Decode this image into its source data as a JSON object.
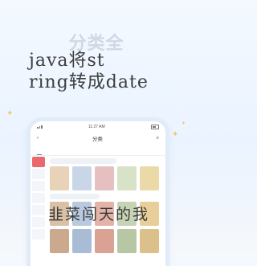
{
  "hero": {
    "title": "分类全"
  },
  "overlay": {
    "line1": "java将st",
    "line2": "ring转成date"
  },
  "phone": {
    "time": "11:27 AM",
    "appbar_title": "分类",
    "tabs": [
      "",
      "",
      "",
      ""
    ],
    "sidebar": [
      "",
      "",
      "",
      "",
      "",
      "",
      "",
      ""
    ]
  },
  "bottom": {
    "text": "韭菜闯天的我"
  },
  "colors": {
    "accent": "#3b7bea",
    "sidebar_active": "#e86a6a",
    "sparkle": "#f3c56a"
  }
}
